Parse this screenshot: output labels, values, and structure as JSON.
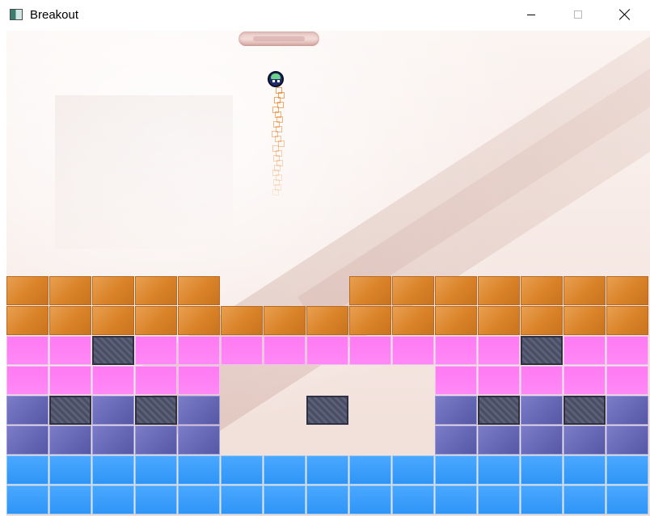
{
  "window": {
    "title": "Breakout",
    "app_icon": "app-window-icon",
    "controls": [
      "minimize-icon",
      "maximize-icon",
      "close-icon"
    ]
  },
  "game": {
    "paddle": "paddle",
    "ball": "ball",
    "colors": {
      "orange": "#d98228",
      "pink": "#ff80f4",
      "purple": "#6466b4",
      "blue": "#3a9cfc",
      "steel": "#4f5369"
    },
    "brick_rows": [
      [
        "orange",
        "orange",
        "orange",
        "orange",
        "orange",
        "",
        "",
        "",
        "orange",
        "orange",
        "orange",
        "orange",
        "orange",
        "orange",
        "orange"
      ],
      [
        "orange",
        "orange",
        "orange",
        "orange",
        "orange",
        "orange",
        "orange",
        "orange",
        "orange",
        "orange",
        "orange",
        "orange",
        "orange",
        "orange",
        "orange"
      ],
      [
        "pink",
        "pink",
        "steel",
        "pink",
        "pink",
        "pink",
        "pink",
        "pink",
        "pink",
        "pink",
        "pink",
        "pink",
        "steel",
        "pink",
        "pink"
      ],
      [
        "pink",
        "pink",
        "pink",
        "pink",
        "pink",
        "",
        "",
        "",
        "",
        "",
        "pink",
        "pink",
        "pink",
        "pink",
        "pink"
      ],
      [
        "purple",
        "steel",
        "purple",
        "steel",
        "purple",
        "",
        "",
        "steel",
        "",
        "",
        "purple",
        "steel",
        "purple",
        "steel",
        "purple"
      ],
      [
        "purple",
        "purple",
        "purple",
        "purple",
        "purple",
        "",
        "",
        "",
        "",
        "",
        "purple",
        "purple",
        "purple",
        "purple",
        "purple"
      ],
      [
        "blue",
        "blue",
        "blue",
        "blue",
        "blue",
        "blue",
        "blue",
        "blue",
        "blue",
        "blue",
        "blue",
        "blue",
        "blue",
        "blue",
        "blue"
      ],
      [
        "blue",
        "blue",
        "blue",
        "blue",
        "blue",
        "blue",
        "blue",
        "blue",
        "blue",
        "blue",
        "blue",
        "blue",
        "blue",
        "blue",
        "blue"
      ]
    ]
  }
}
